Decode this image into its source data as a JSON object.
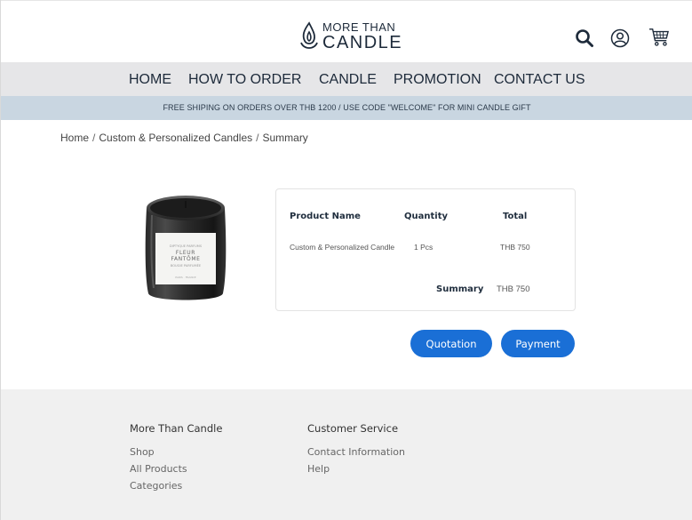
{
  "header": {
    "logo_top": "MORE THAN",
    "logo_bottom": "CANDLE",
    "icons": [
      "search-icon",
      "user-icon",
      "cart-icon"
    ]
  },
  "nav": {
    "items": [
      "HOME",
      "HOW TO ORDER",
      "CANDLE",
      "PROMOTION",
      "CONTACT US"
    ]
  },
  "promo": {
    "text": "FREE SHIPING ON ORDERS OVER THB 1200 / USE CODE \"WELCOME\" FOR MINI CANDLE GIFT"
  },
  "breadcrumb": {
    "items": [
      "Home",
      "Custom & Personalized Candles",
      "Summary"
    ],
    "separator": "/"
  },
  "product_image": {
    "label_line1": "DIPTYQUE PARFUMS",
    "label_line2": "FLEUR",
    "label_line3": "FANTÔME",
    "label_line4": "BOUGIE PARFUMÉE",
    "label_line5": "PARIS · FRANCE"
  },
  "summary": {
    "columns": [
      "Product Name",
      "Quantity",
      "Total"
    ],
    "rows": [
      {
        "product": "Custom & Personalized Candle",
        "quantity": "1 Pcs",
        "total": "THB 750"
      }
    ],
    "summary_label": "Summary",
    "summary_value": "THB 750"
  },
  "buttons": {
    "quotation": "Quotation",
    "payment": "Payment"
  },
  "footer": {
    "col1": {
      "heading": "More Than Candle",
      "links": [
        "Shop",
        "All Products",
        "Categories"
      ]
    },
    "col2": {
      "heading": "Customer Service",
      "links": [
        "Contact Information",
        "Help"
      ]
    }
  },
  "colors": {
    "accent": "#1a6fd6",
    "nav_bg": "#e6e6e8",
    "promo_bg": "#c9d6e1",
    "footer_bg": "#f0f0f0",
    "text_dark": "#1d2a3a"
  }
}
